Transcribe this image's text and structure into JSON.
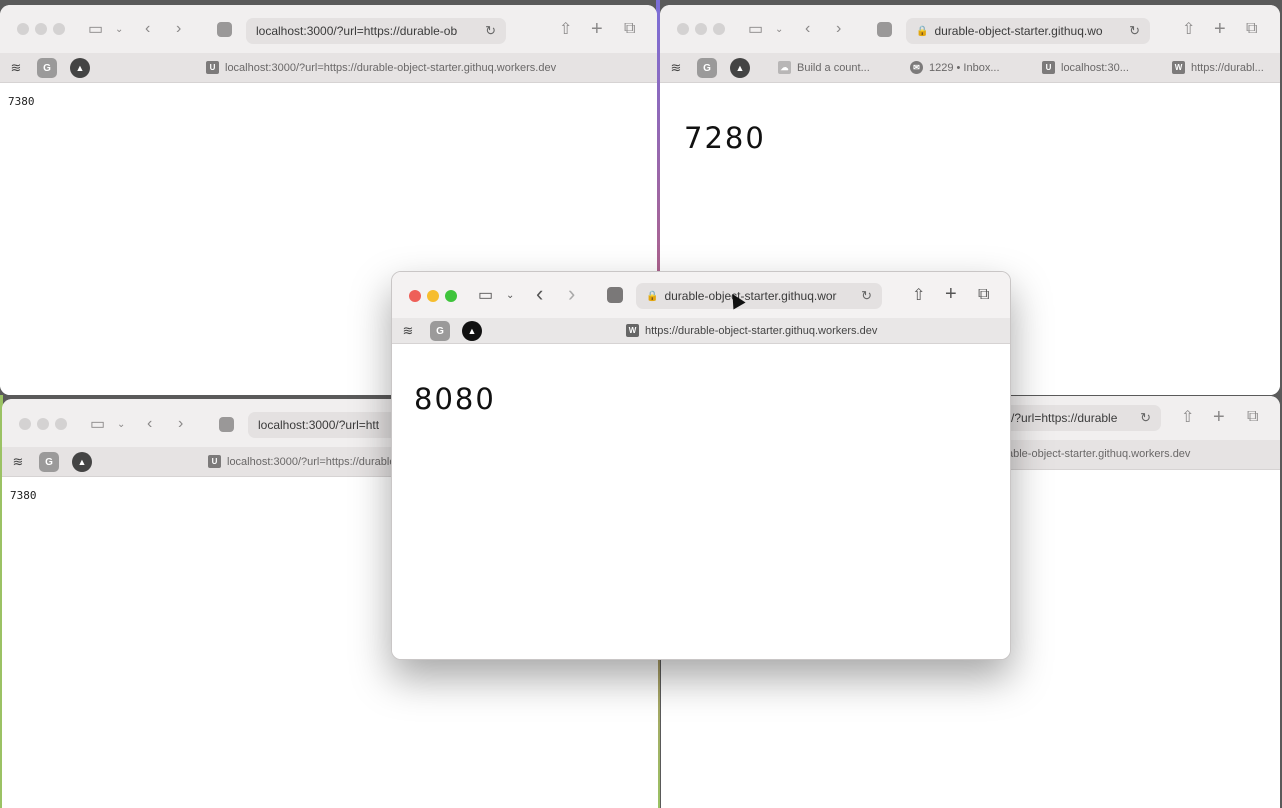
{
  "windows": {
    "top_left": {
      "address": "localhost:3000/?url=https://durable-ob",
      "tab_title": "localhost:3000/?url=https://durable-object-starter.githuq.workers.dev",
      "counter": "7380"
    },
    "top_right": {
      "address": "durable-object-starter.githuq.wo",
      "tabs": [
        "Build a count...",
        "1229 • Inbox...",
        "localhost:30...",
        "https://durabl..."
      ],
      "counter": "7280"
    },
    "bottom_left": {
      "address": "localhost:3000/?url=htt",
      "tab_title": "localhost:3000/?url=https://durable",
      "counter": "7380"
    },
    "bottom_right": {
      "address": "/?url=https://durable",
      "tab_title": "able-object-starter.githuq.workers.dev"
    },
    "center": {
      "address": "durable-object-starter.githuq.wor",
      "tab_title": "https://durable-object-starter.githuq.workers.dev",
      "counter": "8080"
    }
  },
  "extensions": {
    "grey_label": "G"
  },
  "icons": {
    "sidebar": "sidebar-icon",
    "back": "chevron-left-icon",
    "forward": "chevron-right-icon",
    "share": "share-icon",
    "new_tab": "plus-icon",
    "tabs_overview": "tabs-overview-icon",
    "reload": "reload-icon",
    "lock": "lock-icon"
  }
}
